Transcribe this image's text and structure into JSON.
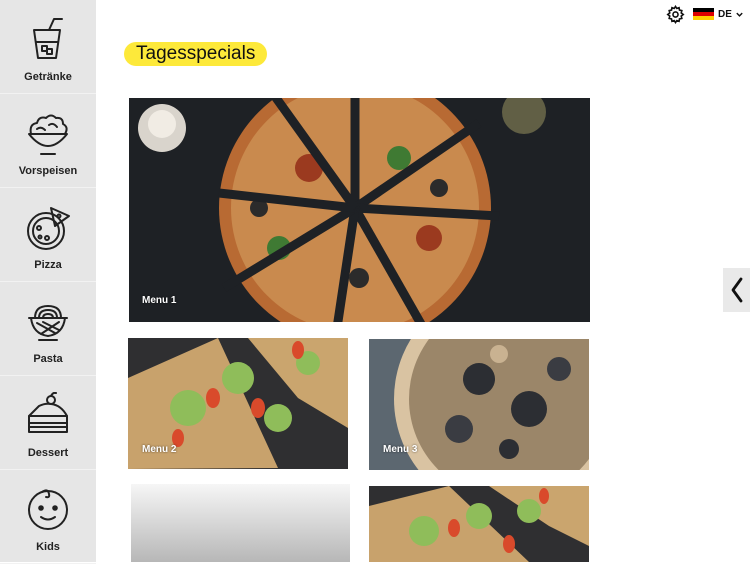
{
  "categories": [
    {
      "label": "Getränke",
      "icon": "drink-icon"
    },
    {
      "label": "Vorspeisen",
      "icon": "salad-bowl-icon"
    },
    {
      "label": "Pizza",
      "icon": "pizza-icon"
    },
    {
      "label": "Pasta",
      "icon": "pasta-icon"
    },
    {
      "label": "Dessert",
      "icon": "cake-icon"
    },
    {
      "label": "Kids",
      "icon": "baby-face-icon"
    }
  ],
  "header": {
    "settings_icon": "gear-icon",
    "language_code": "DE",
    "flag_colors": [
      "#000000",
      "#dd0000",
      "#ffce00"
    ]
  },
  "page": {
    "title": "Tagesspecials"
  },
  "specials": [
    {
      "label": "Menu 1"
    },
    {
      "label": "Menu 2"
    },
    {
      "label": "Menu 3"
    },
    {
      "label": ""
    },
    {
      "label": ""
    }
  ],
  "colors": {
    "accent": "#fde93a",
    "sidebar_bg": "#e6e6e6"
  }
}
